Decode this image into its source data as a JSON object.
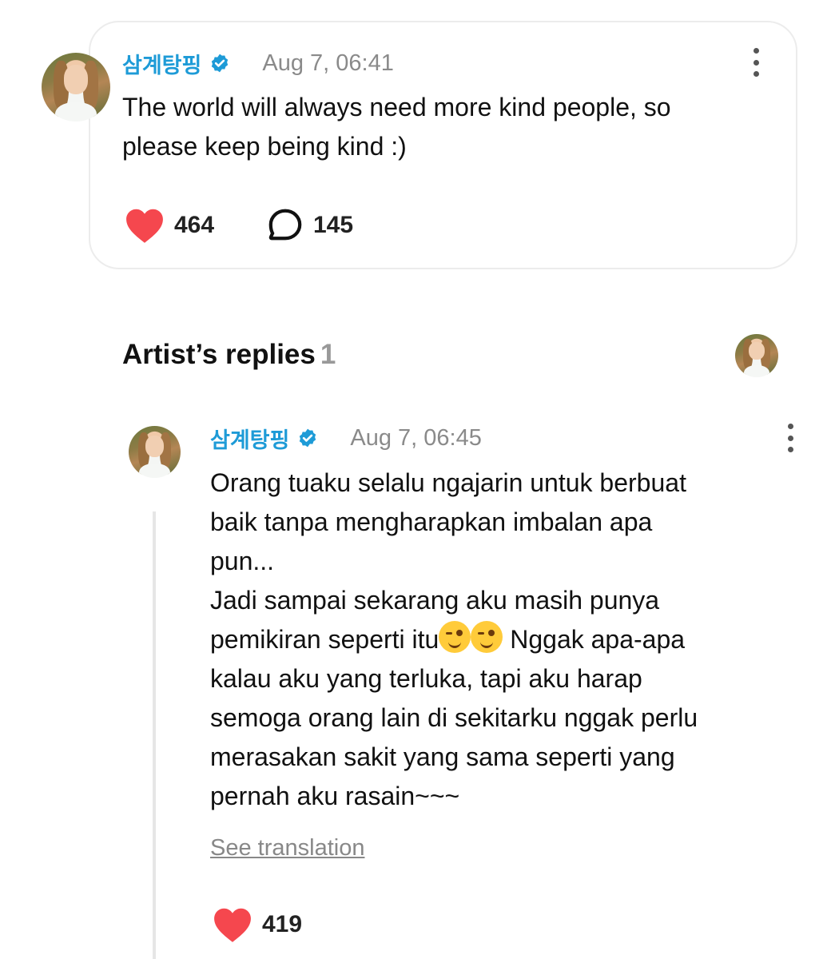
{
  "post": {
    "author": "삼계탕핑",
    "timestamp": "Aug 7, 06:41",
    "text_line1": "The world will always need more kind people, so",
    "text_line2": "please keep being kind :)",
    "likes": "464",
    "comments": "145"
  },
  "replies_section": {
    "title": "Artist’s replies",
    "count": "1"
  },
  "reply": {
    "author": "삼계탕핑",
    "timestamp": "Aug 7, 06:45",
    "lines": {
      "l1": "Orang tuaku selalu ngajarin untuk berbuat",
      "l2": "baik tanpa mengharapkan imbalan apa",
      "l3": "pun...",
      "l4": "Jadi sampai sekarang aku masih punya",
      "l5a": "pemikiran seperti itu",
      "l5b": " Nggak apa-apa",
      "l6": "kalau aku yang terluka, tapi aku harap",
      "l7": "semoga orang lain di sekitarku nggak perlu",
      "l8": "merasakan sakit yang sama seperti yang",
      "l9": "pernah aku rasain~~~"
    },
    "see_translation": "See translation",
    "likes": "419"
  },
  "colors": {
    "accent": "#1e9bd7",
    "heart": "#f5474e"
  },
  "icons": {
    "verified": "verified-check-icon",
    "more": "more-vertical-icon",
    "heart": "heart-icon",
    "comment": "comment-bubble-icon",
    "emoji": "winking-face-emoji"
  }
}
